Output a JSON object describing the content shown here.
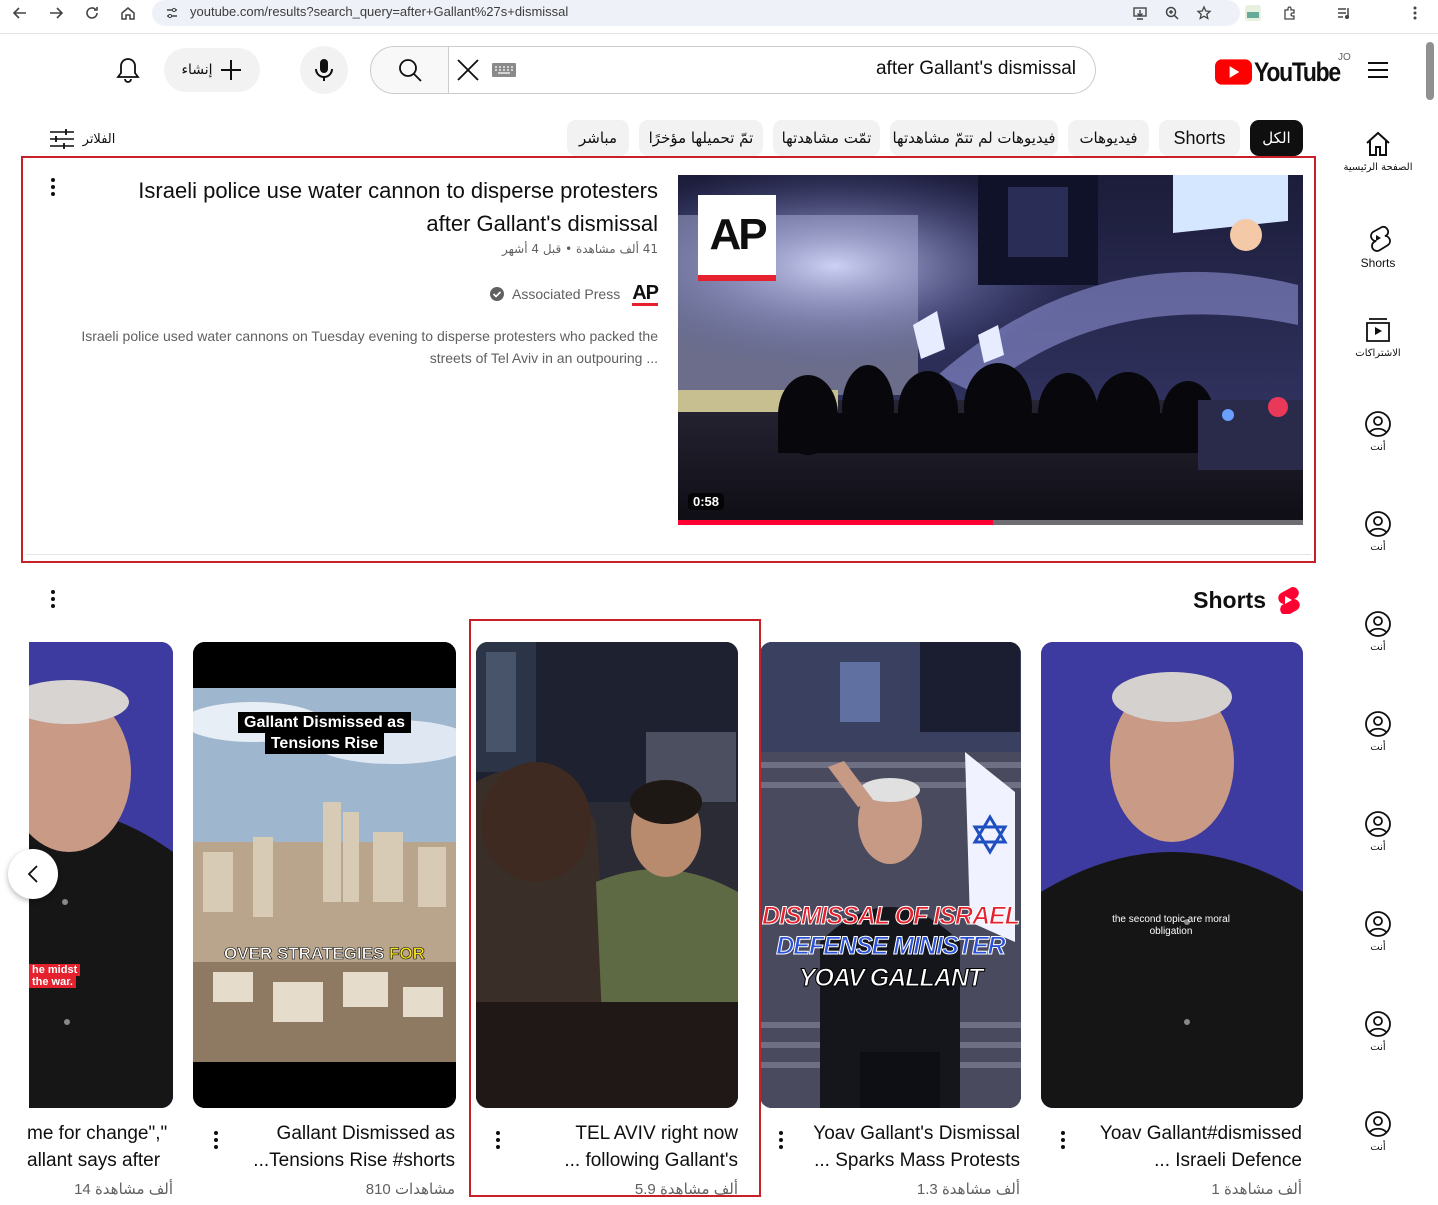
{
  "browser": {
    "url": "youtube.com/results?search_query=after+Gallant%27s+dismissal"
  },
  "header": {
    "logo_text": "YouTube",
    "country_code": "JO",
    "search_value": "after Gallant's dismissal",
    "create_label": "إنشاء"
  },
  "filters": {
    "label": "الفلاتر",
    "chips": [
      "الكل",
      "Shorts",
      "فيديوهات",
      "فيديوهات لم تتمّ مشاهدتها",
      "تمّت مشاهدتها",
      "تمّ تحميلها مؤخرًا",
      "مباشر"
    ]
  },
  "sidebar": {
    "items": [
      {
        "label": "الصفحة الرئيسية",
        "icon": "home-icon"
      },
      {
        "label": "Shorts",
        "icon": "shorts-icon"
      },
      {
        "label": "الاشتراكات",
        "icon": "subscriptions-icon"
      },
      {
        "label": "أنت",
        "icon": "account-icon"
      },
      {
        "label": "أنت",
        "icon": "account-icon"
      },
      {
        "label": "أنت",
        "icon": "account-icon"
      },
      {
        "label": "أنت",
        "icon": "account-icon"
      },
      {
        "label": "أنت",
        "icon": "account-icon"
      },
      {
        "label": "أنت",
        "icon": "account-icon"
      },
      {
        "label": "أنت",
        "icon": "account-icon"
      },
      {
        "label": "أنت",
        "icon": "account-icon"
      }
    ]
  },
  "video": {
    "title_line1": "Israeli police use water cannon to disperse protesters",
    "title_line2": "after Gallant's dismissal",
    "meta": "41 ألف مشاهدة • قبل 4 أشهر",
    "channel": "Associated Press",
    "channel_logo": "AP",
    "desc_line1": "Israeli police used water cannons on Tuesday evening to disperse protesters who packed the",
    "desc_line2": "streets of Tel Aviv in an outpouring ...",
    "duration": "0:58",
    "thumb_logo": "AP"
  },
  "shorts": {
    "heading": "Shorts",
    "items": [
      {
        "line1": "Yoav Gallant#dismissed",
        "line2": "... Israeli Defence",
        "views": "1 ألف مشاهدة",
        "caption": "the second topic are moral obligation"
      },
      {
        "line1": "Yoav Gallant's Dismissal",
        "line2": "... Sparks Mass Protests",
        "views": "1.3 ألف مشاهدة",
        "caption1": "DISMISSAL OF ISRAEL",
        "caption2": "DEFENSE MINISTER",
        "caption3": "YOAV GALLANT"
      },
      {
        "line1": "TEL AVIV right now",
        "line2": "... following Gallant's",
        "views": "5.9 ألف مشاهدة"
      },
      {
        "line1": "Gallant Dismissed as",
        "line2": "...Tensions Rise #shorts",
        "views": "810 مشاهدات",
        "caption1": "Gallant Dismissed as",
        "caption2": "Tensions Rise",
        "caption3": "OVER STRATEGIES",
        "caption4": "FOR"
      },
      {
        "line1": "me for change\",\"",
        "line2": "allant says after",
        "views": "14 ألف مشاهدة",
        "caption1": "he midst",
        "caption2": "the war."
      }
    ]
  }
}
